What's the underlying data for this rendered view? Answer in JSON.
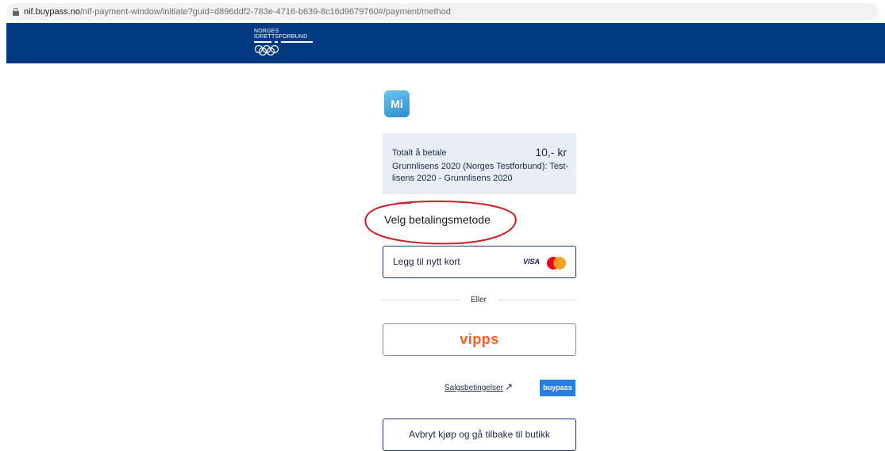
{
  "browser": {
    "url_host": "nif.buypass.no",
    "url_path": "/nif-payment-window/initiate?guid=d896ddf2-783e-4716-b639-8c16d9679760#/payment/method"
  },
  "header": {
    "logo_line1": "NORGES",
    "logo_line2": "IDRETTSFORBUND",
    "background": "#003b82"
  },
  "merchant_badge": "Mi",
  "summary": {
    "total_label": "Totalt å betale",
    "amount": "10,- kr",
    "description": "Grunnlisens 2020 (Norges Testforbund): Test-lisens 2020 - Grunnlisens 2020"
  },
  "payment": {
    "title": "Velg betalingsmetode",
    "add_card_label": "Legg til nytt kort",
    "visa_label": "VISA",
    "or_label": "Eller",
    "vipps_label": "vipps"
  },
  "footer": {
    "terms_label": "Salgsbetingelser",
    "terms_arrow": "↗",
    "buypass_label": "buypass",
    "cancel_label": "Avbryt kjøp og gå tilbake til butikk"
  },
  "colors": {
    "accent": "#1c3a6e",
    "vipps": "#ff5b24",
    "annotation": "#c8222c"
  }
}
